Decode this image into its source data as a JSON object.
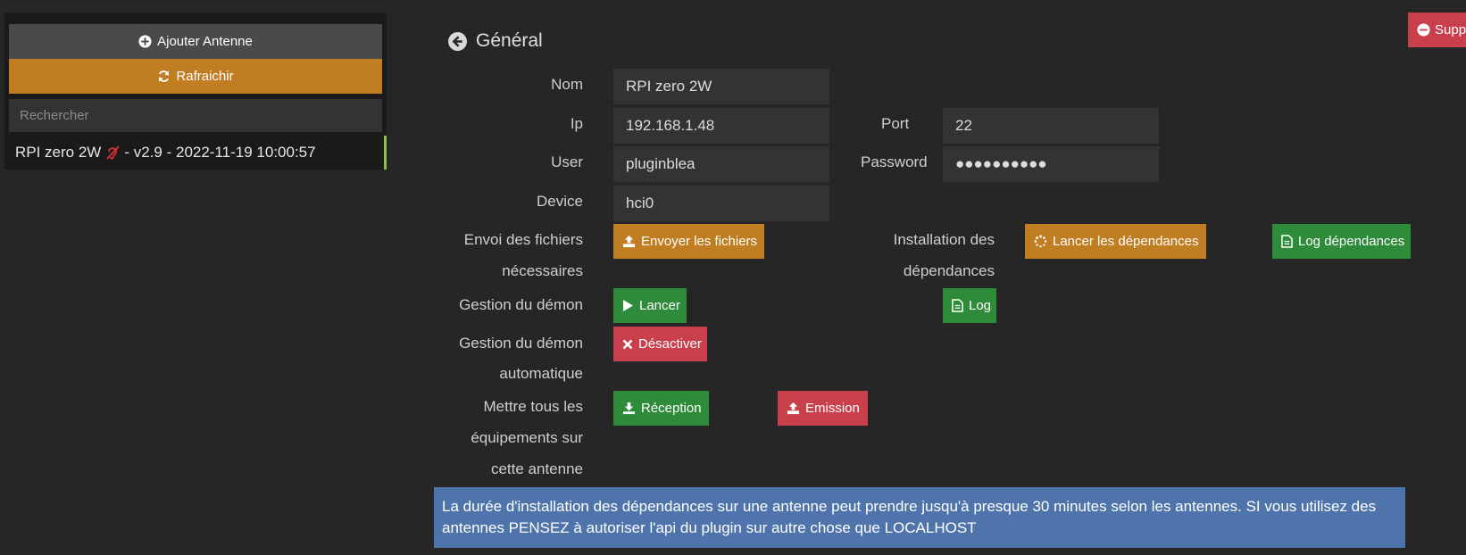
{
  "sidebar": {
    "add_label": "Ajouter Antenne",
    "refresh_label": "Rafraichir",
    "search_placeholder": "Rechercher",
    "item": {
      "name": "RPI zero 2W",
      "details": "- v2.9 - 2022-11-19 10:00:57"
    }
  },
  "header": {
    "title": "Général",
    "delete_label": "Supprimer"
  },
  "form": {
    "nom_label": "Nom",
    "nom_value": "RPI zero 2W",
    "ip_label": "Ip",
    "ip_value": "192.168.1.48",
    "port_label": "Port",
    "port_value": "22",
    "user_label": "User",
    "user_value": "pluginblea",
    "password_label": "Password",
    "password_value": "●●●●●●●●●●",
    "device_label": "Device",
    "device_value": "hci0",
    "send_label_1": "Envoi des fichiers",
    "send_label_2": "nécessaires",
    "send_button": "Envoyer les fichiers",
    "install_label_1": "Installation des",
    "install_label_2": "dépendances",
    "install_button": "Lancer les dépendances",
    "log_deps_button": "Log dépendances",
    "daemon_label": "Gestion du démon",
    "start_button": "Lancer",
    "log_button": "Log",
    "auto_label_1": "Gestion du démon",
    "auto_label_2": "automatique",
    "disable_button": "Désactiver",
    "all_label_1": "Mettre tous les",
    "all_label_2": "équipements sur",
    "all_label_3": "cette antenne",
    "reception_button": "Réception",
    "emission_button": "Emission"
  },
  "info": {
    "text": "La durée d'installation des dépendances sur une antenne peut prendre jusqu'à presque 30 minutes selon les antennes. SI vous utilisez des antennes PENSEZ à autoriser l'api du plugin sur autre chose que LOCALHOST"
  },
  "colors": {
    "background": "#262626",
    "orange": "#c17d22",
    "green": "#2e8b3a",
    "red": "#c9404c",
    "info_blue": "#4f74ab",
    "status_green": "#8bc34a"
  }
}
